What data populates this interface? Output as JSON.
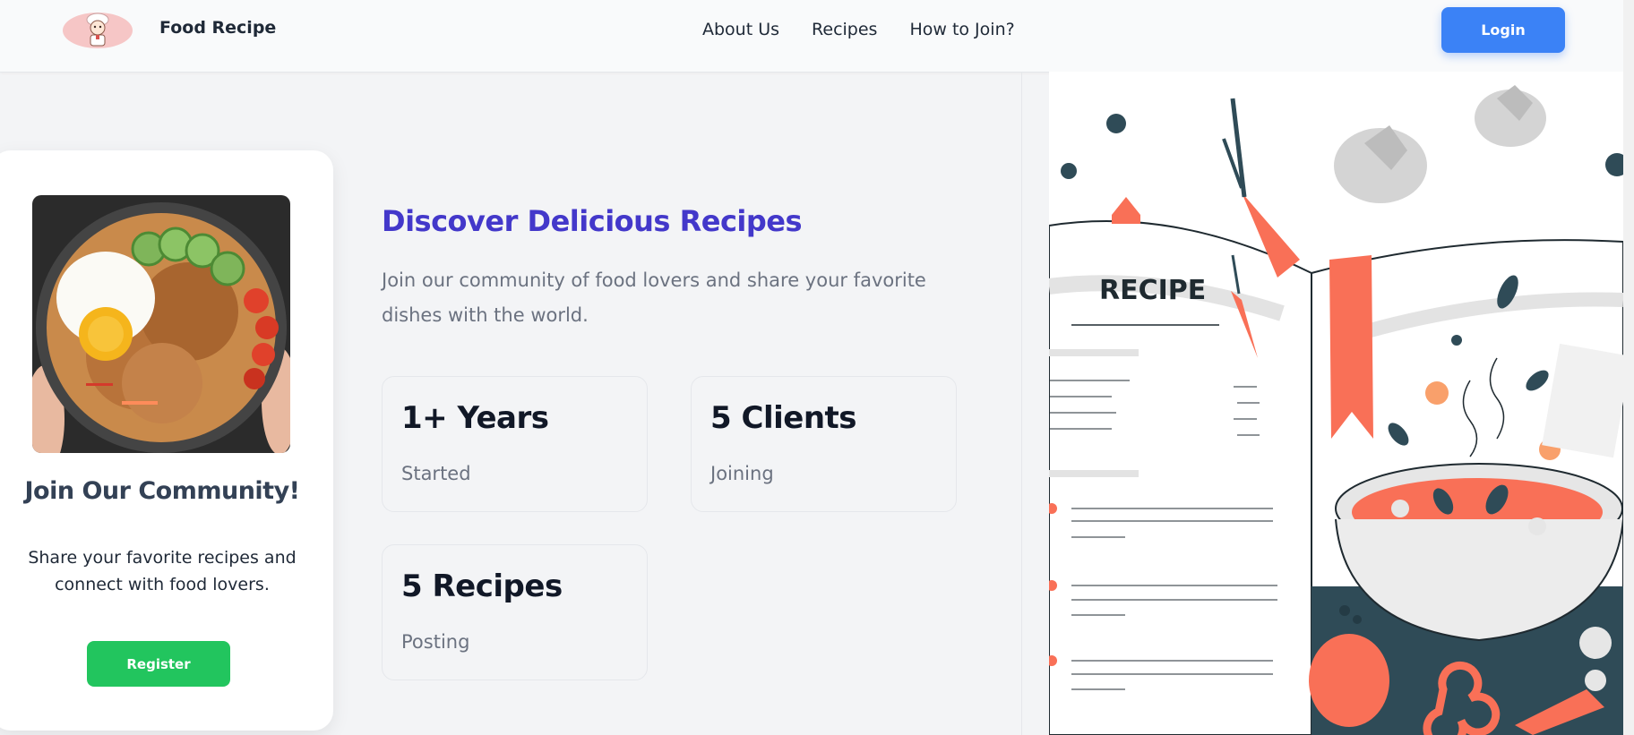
{
  "header": {
    "brand": "Food Recipe",
    "nav": [
      "About Us",
      "Recipes",
      "How to Join?"
    ],
    "login_label": "Login"
  },
  "community": {
    "title": "Join Our Community!",
    "text": "Share your favorite recipes and connect with food lovers.",
    "register_label": "Register"
  },
  "hero": {
    "title": "Discover Delicious Recipes",
    "text": "Join our community of food lovers and share your favorite dishes with the world."
  },
  "stats": [
    {
      "value": "1+ Years",
      "label": "Started"
    },
    {
      "value": "5 Clients",
      "label": "Joining"
    },
    {
      "value": "5 Recipes",
      "label": "Posting"
    }
  ],
  "illustration": {
    "book_label": "RECIPE"
  },
  "colors": {
    "accent": "#4338ca",
    "login": "#3b82f6",
    "register": "#22c55e",
    "orange": "#f97057",
    "teal": "#2f4b57"
  },
  "icons": [
    "chef-logo-icon"
  ]
}
